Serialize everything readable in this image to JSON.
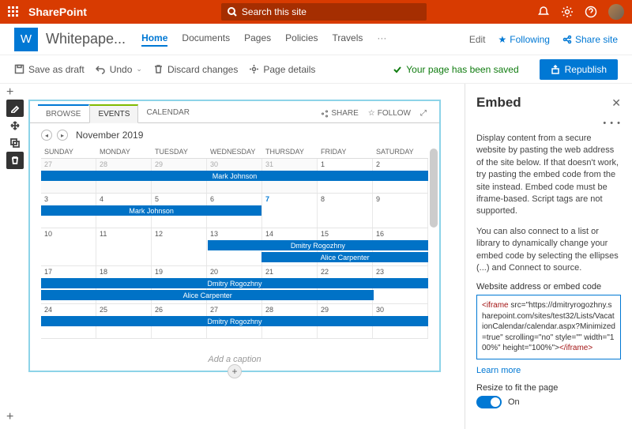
{
  "suite": {
    "app": "SharePoint",
    "search_placeholder": "Search this site"
  },
  "site": {
    "logo_letter": "W",
    "name": "Whitepape...",
    "nav": [
      "Home",
      "Documents",
      "Pages",
      "Policies",
      "Travels"
    ],
    "edit": "Edit",
    "following": "Following",
    "share": "Share site"
  },
  "cmd": {
    "save_draft": "Save as draft",
    "undo": "Undo",
    "discard": "Discard changes",
    "page_details": "Page details",
    "saved_msg": "Your page has been saved",
    "republish": "Republish"
  },
  "webpart": {
    "tabs": [
      "BROWSE",
      "EVENTS",
      "CALENDAR"
    ],
    "share": "SHARE",
    "follow": "FOLLOW",
    "caption": "Add a caption"
  },
  "calendar": {
    "month": "November 2019",
    "day_headers": [
      "SUNDAY",
      "MONDAY",
      "TUESDAY",
      "WEDNESDAY",
      "THURSDAY",
      "FRIDAY",
      "SATURDAY"
    ],
    "weeks": [
      [
        "27",
        "28",
        "29",
        "30",
        "31",
        "1",
        "2"
      ],
      [
        "3",
        "4",
        "5",
        "6",
        "7",
        "8",
        "9"
      ],
      [
        "10",
        "11",
        "12",
        "13",
        "14",
        "15",
        "16"
      ],
      [
        "17",
        "18",
        "19",
        "20",
        "21",
        "22",
        "23"
      ],
      [
        "24",
        "25",
        "26",
        "27",
        "28",
        "29",
        "30"
      ]
    ],
    "events_w0": [
      {
        "label": "Mark Johnson"
      }
    ],
    "events_w1": [
      {
        "label": "Mark Johnson"
      }
    ],
    "events_w2": [
      {
        "label": "Dmitry Rogozhny"
      },
      {
        "label": "Alice Carpenter"
      }
    ],
    "events_w3": [
      {
        "label": "Dmitry Rogozhny"
      },
      {
        "label": "Alice Carpenter"
      }
    ],
    "events_w4": [
      {
        "label": "Dmitry Rogozhny"
      }
    ]
  },
  "panel": {
    "title": "Embed",
    "p1": "Display content from a secure website by pasting the web address of the site below. If that doesn't work, try pasting the embed code from the site instead. Embed code must be iframe-based. Script tags are not supported.",
    "p2": "You can also connect to a list or library to dynamically change your embed code by selecting the ellipses (...) and Connect to source.",
    "label": "Website address or embed code",
    "code_open": "<iframe",
    "code_body": " src=\"https://dmitryrogozhny.sharepoint.com/sites/test32/Lists/VacationCalendar/calendar.aspx?Minimized=true\" scrolling=\"no\" style=\"\" width=\"100%\" height=\"100%\">",
    "code_close": "</iframe>",
    "learn": "Learn more",
    "resize_label": "Resize to fit the page",
    "toggle_label": "On"
  }
}
